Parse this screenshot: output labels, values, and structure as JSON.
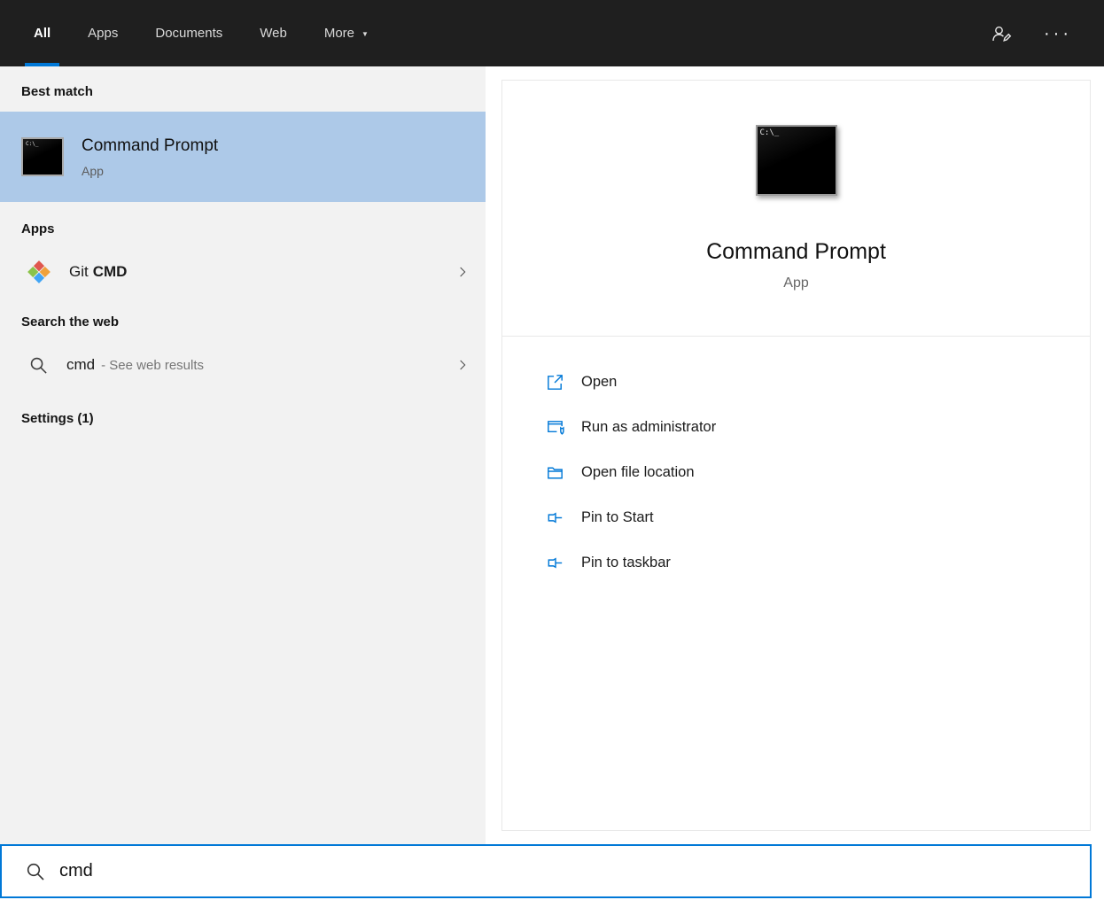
{
  "colors": {
    "accent": "#0078d7",
    "topbar_bg": "#1f1f1f",
    "left_bg": "#f2f2f2",
    "highlight": "#adc9e8"
  },
  "topbar": {
    "tabs": [
      "All",
      "Apps",
      "Documents",
      "Web",
      "More"
    ],
    "active_tab": "All",
    "more_caret": "▼",
    "ellipsis": "···"
  },
  "icons": {
    "cmd_glyph": "C:\\_"
  },
  "left_panel": {
    "best_match_header": "Best match",
    "best_match": {
      "title": "Command Prompt",
      "subtitle": "App"
    },
    "apps_header": "Apps",
    "git_item": {
      "prefix": "Git",
      "match": "CMD"
    },
    "web_header": "Search the web",
    "web_item": {
      "query": "cmd",
      "hint": "- See web results"
    },
    "settings_header": "Settings (1)"
  },
  "preview": {
    "title": "Command Prompt",
    "subtitle": "App",
    "actions": [
      {
        "label": "Open",
        "icon": "open-icon"
      },
      {
        "label": "Run as administrator",
        "icon": "admin-shield-icon"
      },
      {
        "label": "Open file location",
        "icon": "folder-icon"
      },
      {
        "label": "Pin to Start",
        "icon": "pin-icon"
      },
      {
        "label": "Pin to taskbar",
        "icon": "pin-icon"
      }
    ]
  },
  "search_box": {
    "value": "cmd"
  }
}
